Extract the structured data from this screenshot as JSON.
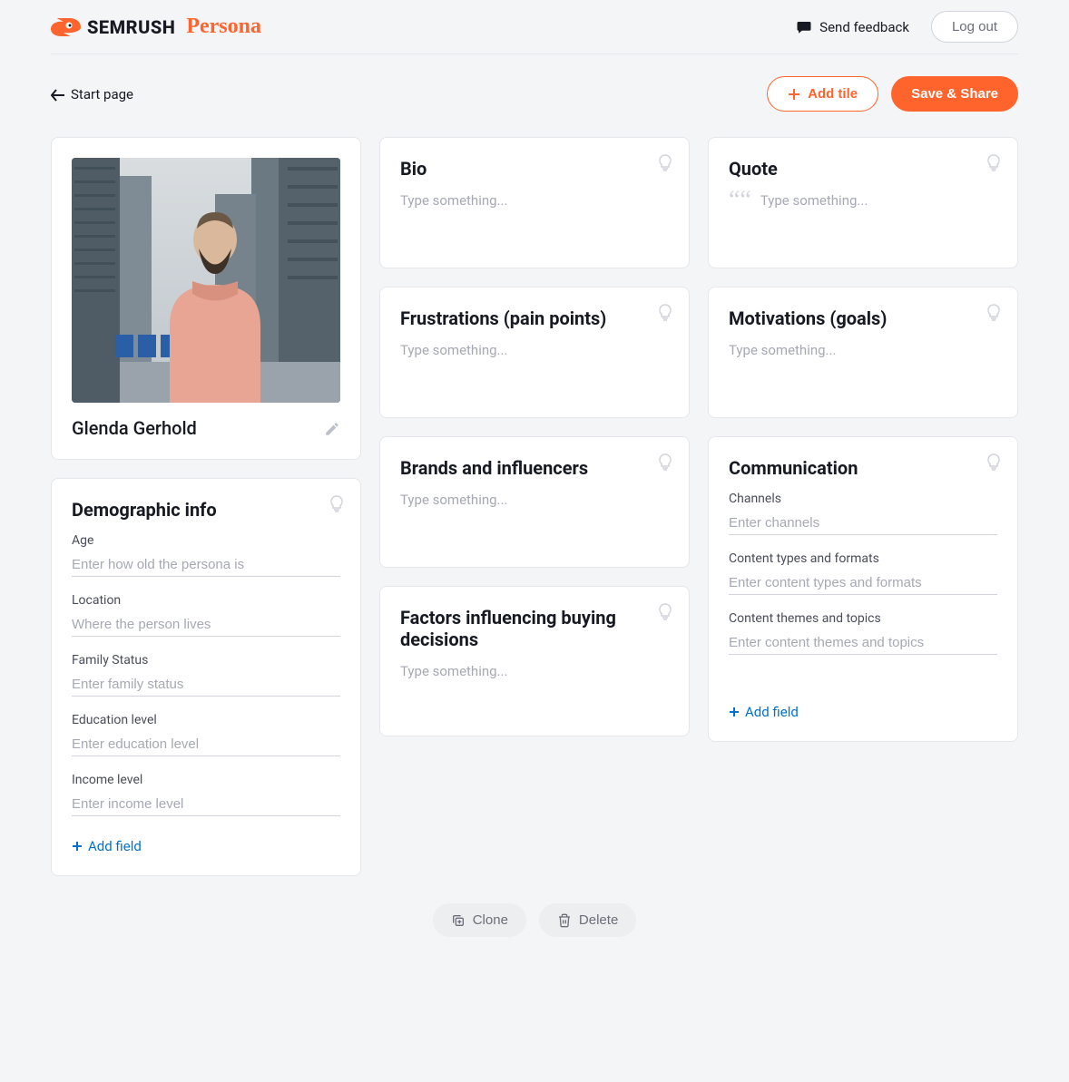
{
  "header": {
    "brand_main": "SEMRUSH",
    "brand_sub": "Persona",
    "feedback": "Send feedback",
    "logout": "Log out"
  },
  "actions": {
    "back": "Start page",
    "add_tile": "Add tile",
    "save": "Save & Share"
  },
  "persona": {
    "name": "Glenda Gerhold"
  },
  "tiles": {
    "bio": {
      "title": "Bio",
      "placeholder": "Type something..."
    },
    "quote": {
      "title": "Quote",
      "placeholder": "Type something..."
    },
    "frustrations": {
      "title": "Frustrations (pain points)",
      "placeholder": "Type something..."
    },
    "motivations": {
      "title": "Motivations (goals)",
      "placeholder": "Type something..."
    },
    "brands": {
      "title": "Brands and influencers",
      "placeholder": "Type something..."
    },
    "factors": {
      "title": "Factors influencing buying decisions",
      "placeholder": "Type something..."
    }
  },
  "demographic": {
    "title": "Demographic info",
    "fields": [
      {
        "label": "Age",
        "placeholder": "Enter how old the persona is"
      },
      {
        "label": "Location",
        "placeholder": "Where the person lives"
      },
      {
        "label": "Family Status",
        "placeholder": "Enter family status"
      },
      {
        "label": "Education level",
        "placeholder": "Enter education level"
      },
      {
        "label": "Income level",
        "placeholder": "Enter income level"
      }
    ],
    "add_field": "Add field"
  },
  "communication": {
    "title": "Communication",
    "fields": [
      {
        "label": "Channels",
        "placeholder": "Enter channels"
      },
      {
        "label": "Content types and formats",
        "placeholder": "Enter content types and formats"
      },
      {
        "label": "Content themes and topics",
        "placeholder": "Enter content themes and topics"
      }
    ],
    "add_field": "Add field"
  },
  "footer": {
    "clone": "Clone",
    "delete": "Delete"
  }
}
